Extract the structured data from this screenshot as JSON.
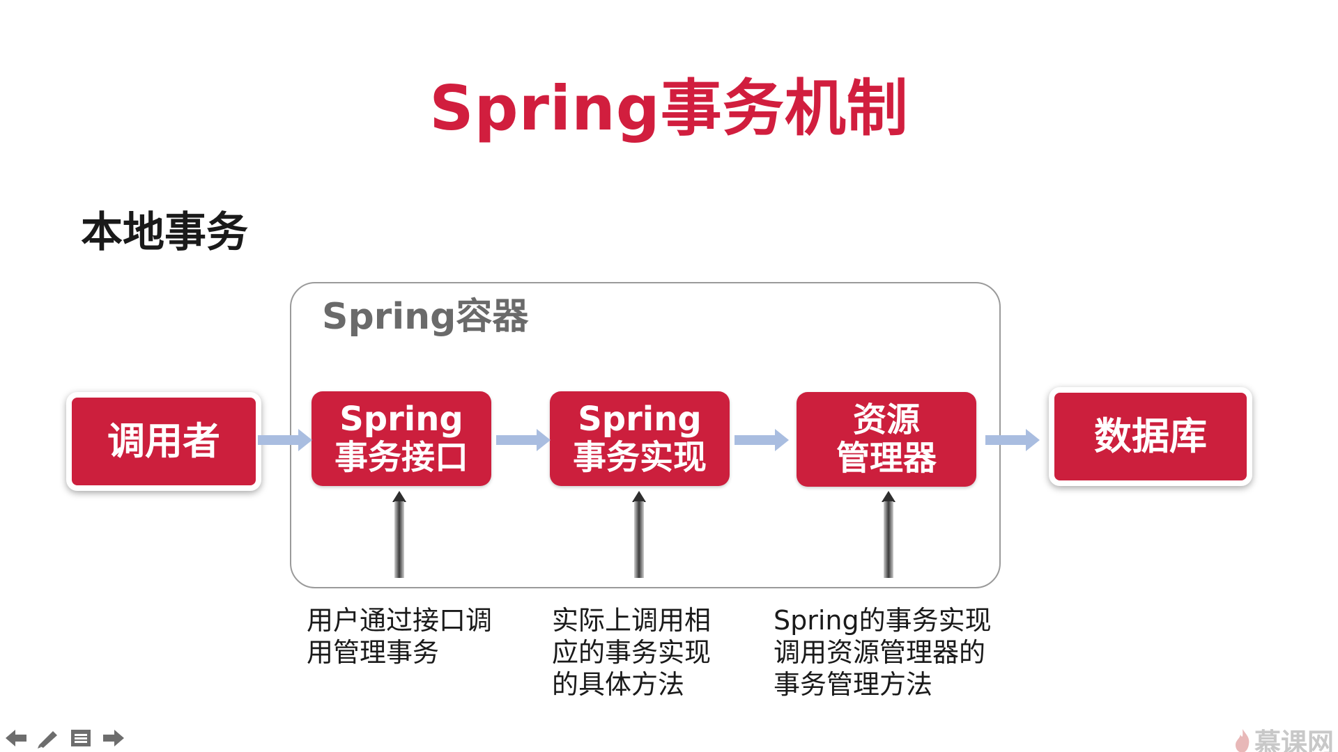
{
  "slide": {
    "title": "Spring事务机制",
    "subtitle": "本地事务",
    "container_label": "Spring容器"
  },
  "boxes": {
    "caller": "调用者",
    "interface": [
      "Spring",
      "事务接口"
    ],
    "impl": [
      "Spring",
      "事务实现"
    ],
    "resource": [
      "资源",
      "管理器"
    ],
    "database": "数据库"
  },
  "notes": {
    "interface": [
      "用户通过接口调",
      "用管理事务"
    ],
    "impl": [
      "实际上调用相",
      "应的事务实现",
      "的具体方法"
    ],
    "resource": [
      "Spring的事务实现",
      "调用资源管理器的",
      "事务管理方法"
    ]
  },
  "watermark": "慕课网",
  "colors": {
    "accent": "#cc1f3d",
    "title": "#d11e3e",
    "flow_arrow": "#a9bde0"
  },
  "toolbar_icons": [
    "arrow-left-icon",
    "pen-icon",
    "menu-icon",
    "arrow-right-icon"
  ]
}
